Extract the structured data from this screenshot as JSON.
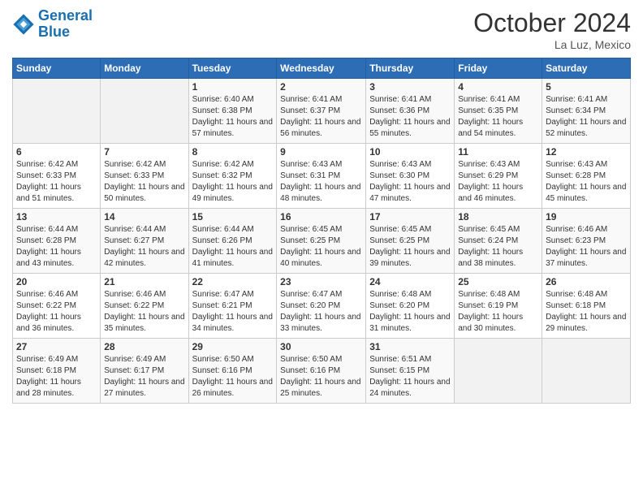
{
  "header": {
    "logo_line1": "General",
    "logo_line2": "Blue",
    "month_title": "October 2024",
    "location": "La Luz, Mexico"
  },
  "weekdays": [
    "Sunday",
    "Monday",
    "Tuesday",
    "Wednesday",
    "Thursday",
    "Friday",
    "Saturday"
  ],
  "weeks": [
    [
      {
        "day": "",
        "sunrise": "",
        "sunset": "",
        "daylight": ""
      },
      {
        "day": "",
        "sunrise": "",
        "sunset": "",
        "daylight": ""
      },
      {
        "day": "1",
        "sunrise": "Sunrise: 6:40 AM",
        "sunset": "Sunset: 6:38 PM",
        "daylight": "Daylight: 11 hours and 57 minutes."
      },
      {
        "day": "2",
        "sunrise": "Sunrise: 6:41 AM",
        "sunset": "Sunset: 6:37 PM",
        "daylight": "Daylight: 11 hours and 56 minutes."
      },
      {
        "day": "3",
        "sunrise": "Sunrise: 6:41 AM",
        "sunset": "Sunset: 6:36 PM",
        "daylight": "Daylight: 11 hours and 55 minutes."
      },
      {
        "day": "4",
        "sunrise": "Sunrise: 6:41 AM",
        "sunset": "Sunset: 6:35 PM",
        "daylight": "Daylight: 11 hours and 54 minutes."
      },
      {
        "day": "5",
        "sunrise": "Sunrise: 6:41 AM",
        "sunset": "Sunset: 6:34 PM",
        "daylight": "Daylight: 11 hours and 52 minutes."
      }
    ],
    [
      {
        "day": "6",
        "sunrise": "Sunrise: 6:42 AM",
        "sunset": "Sunset: 6:33 PM",
        "daylight": "Daylight: 11 hours and 51 minutes."
      },
      {
        "day": "7",
        "sunrise": "Sunrise: 6:42 AM",
        "sunset": "Sunset: 6:33 PM",
        "daylight": "Daylight: 11 hours and 50 minutes."
      },
      {
        "day": "8",
        "sunrise": "Sunrise: 6:42 AM",
        "sunset": "Sunset: 6:32 PM",
        "daylight": "Daylight: 11 hours and 49 minutes."
      },
      {
        "day": "9",
        "sunrise": "Sunrise: 6:43 AM",
        "sunset": "Sunset: 6:31 PM",
        "daylight": "Daylight: 11 hours and 48 minutes."
      },
      {
        "day": "10",
        "sunrise": "Sunrise: 6:43 AM",
        "sunset": "Sunset: 6:30 PM",
        "daylight": "Daylight: 11 hours and 47 minutes."
      },
      {
        "day": "11",
        "sunrise": "Sunrise: 6:43 AM",
        "sunset": "Sunset: 6:29 PM",
        "daylight": "Daylight: 11 hours and 46 minutes."
      },
      {
        "day": "12",
        "sunrise": "Sunrise: 6:43 AM",
        "sunset": "Sunset: 6:28 PM",
        "daylight": "Daylight: 11 hours and 45 minutes."
      }
    ],
    [
      {
        "day": "13",
        "sunrise": "Sunrise: 6:44 AM",
        "sunset": "Sunset: 6:28 PM",
        "daylight": "Daylight: 11 hours and 43 minutes."
      },
      {
        "day": "14",
        "sunrise": "Sunrise: 6:44 AM",
        "sunset": "Sunset: 6:27 PM",
        "daylight": "Daylight: 11 hours and 42 minutes."
      },
      {
        "day": "15",
        "sunrise": "Sunrise: 6:44 AM",
        "sunset": "Sunset: 6:26 PM",
        "daylight": "Daylight: 11 hours and 41 minutes."
      },
      {
        "day": "16",
        "sunrise": "Sunrise: 6:45 AM",
        "sunset": "Sunset: 6:25 PM",
        "daylight": "Daylight: 11 hours and 40 minutes."
      },
      {
        "day": "17",
        "sunrise": "Sunrise: 6:45 AM",
        "sunset": "Sunset: 6:25 PM",
        "daylight": "Daylight: 11 hours and 39 minutes."
      },
      {
        "day": "18",
        "sunrise": "Sunrise: 6:45 AM",
        "sunset": "Sunset: 6:24 PM",
        "daylight": "Daylight: 11 hours and 38 minutes."
      },
      {
        "day": "19",
        "sunrise": "Sunrise: 6:46 AM",
        "sunset": "Sunset: 6:23 PM",
        "daylight": "Daylight: 11 hours and 37 minutes."
      }
    ],
    [
      {
        "day": "20",
        "sunrise": "Sunrise: 6:46 AM",
        "sunset": "Sunset: 6:22 PM",
        "daylight": "Daylight: 11 hours and 36 minutes."
      },
      {
        "day": "21",
        "sunrise": "Sunrise: 6:46 AM",
        "sunset": "Sunset: 6:22 PM",
        "daylight": "Daylight: 11 hours and 35 minutes."
      },
      {
        "day": "22",
        "sunrise": "Sunrise: 6:47 AM",
        "sunset": "Sunset: 6:21 PM",
        "daylight": "Daylight: 11 hours and 34 minutes."
      },
      {
        "day": "23",
        "sunrise": "Sunrise: 6:47 AM",
        "sunset": "Sunset: 6:20 PM",
        "daylight": "Daylight: 11 hours and 33 minutes."
      },
      {
        "day": "24",
        "sunrise": "Sunrise: 6:48 AM",
        "sunset": "Sunset: 6:20 PM",
        "daylight": "Daylight: 11 hours and 31 minutes."
      },
      {
        "day": "25",
        "sunrise": "Sunrise: 6:48 AM",
        "sunset": "Sunset: 6:19 PM",
        "daylight": "Daylight: 11 hours and 30 minutes."
      },
      {
        "day": "26",
        "sunrise": "Sunrise: 6:48 AM",
        "sunset": "Sunset: 6:18 PM",
        "daylight": "Daylight: 11 hours and 29 minutes."
      }
    ],
    [
      {
        "day": "27",
        "sunrise": "Sunrise: 6:49 AM",
        "sunset": "Sunset: 6:18 PM",
        "daylight": "Daylight: 11 hours and 28 minutes."
      },
      {
        "day": "28",
        "sunrise": "Sunrise: 6:49 AM",
        "sunset": "Sunset: 6:17 PM",
        "daylight": "Daylight: 11 hours and 27 minutes."
      },
      {
        "day": "29",
        "sunrise": "Sunrise: 6:50 AM",
        "sunset": "Sunset: 6:16 PM",
        "daylight": "Daylight: 11 hours and 26 minutes."
      },
      {
        "day": "30",
        "sunrise": "Sunrise: 6:50 AM",
        "sunset": "Sunset: 6:16 PM",
        "daylight": "Daylight: 11 hours and 25 minutes."
      },
      {
        "day": "31",
        "sunrise": "Sunrise: 6:51 AM",
        "sunset": "Sunset: 6:15 PM",
        "daylight": "Daylight: 11 hours and 24 minutes."
      },
      {
        "day": "",
        "sunrise": "",
        "sunset": "",
        "daylight": ""
      },
      {
        "day": "",
        "sunrise": "",
        "sunset": "",
        "daylight": ""
      }
    ]
  ]
}
